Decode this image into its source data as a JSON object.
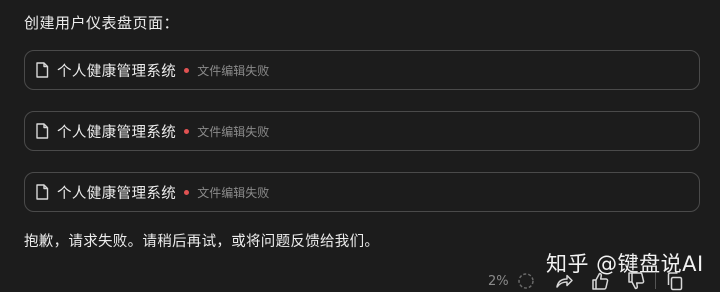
{
  "heading": "创建用户仪表盘页面：",
  "files": [
    {
      "name": "个人健康管理系统",
      "status": "文件编辑失败"
    },
    {
      "name": "个人健康管理系统",
      "status": "文件编辑失败"
    },
    {
      "name": "个人健康管理系统",
      "status": "文件编辑失败"
    }
  ],
  "error_message": "抱歉，请求失败。请稍后再试，或将问题反馈给我们。",
  "watermark": "知乎 @键盘说AI",
  "toolbar": {
    "progress": "2%",
    "icons": [
      "loading-ring-icon",
      "share-icon",
      "thumbs-up-icon",
      "thumbs-down-icon",
      "copy-icon"
    ]
  },
  "colors": {
    "background": "#1c1c1c",
    "border": "#4a4a4a",
    "status_dot": "#e05252"
  }
}
